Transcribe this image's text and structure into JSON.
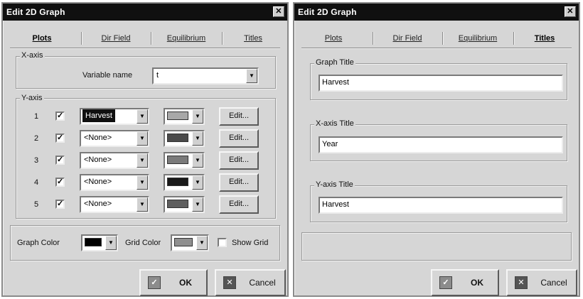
{
  "left_dialog": {
    "title": "Edit 2D Graph",
    "close_glyph": "✕",
    "tabs": [
      {
        "label": "Plots",
        "active": true
      },
      {
        "label": "Dir Field",
        "active": false
      },
      {
        "label": "Equilibrium",
        "active": false
      },
      {
        "label": "Titles",
        "active": false
      }
    ],
    "xaxis": {
      "group_label": "X-axis",
      "variable_label": "Variable name",
      "variable_value": "t"
    },
    "yaxis": {
      "group_label": "Y-axis",
      "edit_label": "Edit...",
      "rows": [
        {
          "num": "1",
          "checked": true,
          "variable": "Harvest",
          "color": "#a8a8a8"
        },
        {
          "num": "2",
          "checked": true,
          "variable": "<None>",
          "color": "#4a4a4a"
        },
        {
          "num": "3",
          "checked": true,
          "variable": "<None>",
          "color": "#7a7a7a"
        },
        {
          "num": "4",
          "checked": true,
          "variable": "<None>",
          "color": "#1a1a1a"
        },
        {
          "num": "5",
          "checked": true,
          "variable": "<None>",
          "color": "#5e5e5e"
        }
      ]
    },
    "graph_color_label": "Graph Color",
    "graph_color": "#000000",
    "grid_color_label": "Grid Color",
    "grid_color": "#8f8f8f",
    "show_grid_label": "Show Grid",
    "show_grid_checked": false,
    "ok_label": "OK",
    "cancel_label": "Cancel"
  },
  "right_dialog": {
    "title": "Edit 2D Graph",
    "close_glyph": "✕",
    "tabs": [
      {
        "label": "Plots",
        "active": false
      },
      {
        "label": "Dir Field",
        "active": false
      },
      {
        "label": "Equilibrium",
        "active": false
      },
      {
        "label": "Titles",
        "active": true
      }
    ],
    "graph_title_label": "Graph Title",
    "graph_title_value": "Harvest",
    "xaxis_title_label": "X-axis Title",
    "xaxis_title_value": "Year",
    "yaxis_title_label": "Y-axis Title",
    "yaxis_title_value": "Harvest",
    "ok_label": "OK",
    "cancel_label": "Cancel"
  },
  "icons": {
    "check": "✓",
    "cross": "✕",
    "dropdown": "▼",
    "checkmark_box": "✓"
  }
}
